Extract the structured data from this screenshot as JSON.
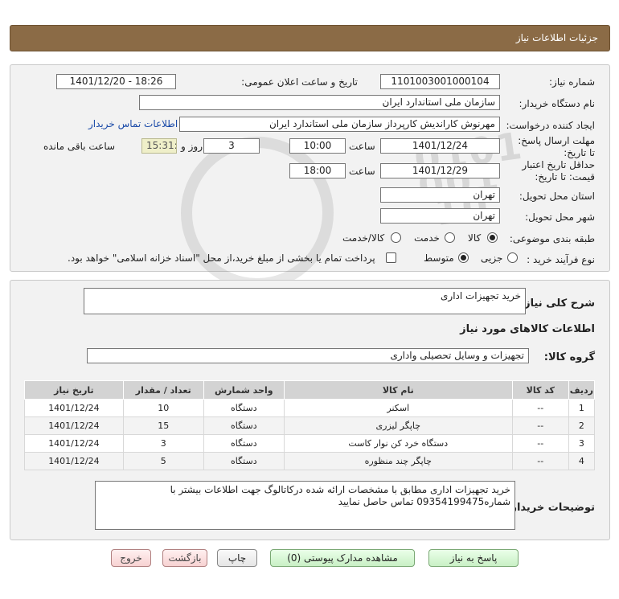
{
  "header": {
    "title": "جزئیات اطلاعات نیاز"
  },
  "form": {
    "need_number_label": "شماره نیاز:",
    "need_number": "1101003001000104",
    "announce_label": "تاریخ و ساعت اعلان عمومی:",
    "announce_value": "1401/12/20 - 18:26",
    "buyer_org_label": "نام دستگاه خریدار:",
    "buyer_org": "سازمان ملی استاندارد ایران",
    "creator_label": "ایجاد کننده درخواست:",
    "creator": "مهرنوش کاراندیش کارپرداز سازمان ملی استاندارد ایران",
    "contact_link": "اطلاعات تماس خریدار",
    "reply_deadline_label": "مهلت ارسال پاسخ: تا تاریخ:",
    "reply_date": "1401/12/24",
    "time_label": "ساعت",
    "reply_time": "10:00",
    "days_value": "3",
    "days_and_label": "روز و",
    "remaining_time": "15:31:46",
    "remaining_label": "ساعت باقی مانده",
    "validity_label": "حداقل تاریخ اعتبار قیمت: تا تاریخ:",
    "validity_date": "1401/12/29",
    "validity_time": "18:00",
    "province_label": "استان محل تحویل:",
    "province": "تهران",
    "city_label": "شهر محل تحویل:",
    "city": "تهران",
    "category_label": "طبقه بندی موضوعی:",
    "category_options": [
      "کالا",
      "خدمت",
      "کالا/خدمت"
    ],
    "process_label": "نوع فرآیند خرید :",
    "process_options": [
      "جزیی",
      "متوسط"
    ],
    "payment_note": "پرداخت تمام یا بخشی از مبلغ خرید،از محل \"اسناد خزانه اسلامی\" خواهد بود."
  },
  "summary": {
    "general_desc_label": "شرح کلی نیاز:",
    "general_desc": "خرید تجهیزات اداری",
    "goods_info_title": "اطلاعات کالاهای مورد نیاز",
    "goods_group_label": "گروه کالا:",
    "goods_group": "تجهیزات و وسایل تحصیلی واداری"
  },
  "table": {
    "headers": [
      "ردیف",
      "کد کالا",
      "نام کالا",
      "واحد شمارش",
      "تعداد / مقدار",
      "تاریخ نیاز"
    ],
    "rows": [
      [
        "1",
        "--",
        "اسکنر",
        "دستگاه",
        "10",
        "1401/12/24"
      ],
      [
        "2",
        "--",
        "چاپگر لیزری",
        "دستگاه",
        "15",
        "1401/12/24"
      ],
      [
        "3",
        "--",
        "دستگاه خرد کن نوار کاست",
        "دستگاه",
        "3",
        "1401/12/24"
      ],
      [
        "4",
        "--",
        "چاپگر چند منظوره",
        "دستگاه",
        "5",
        "1401/12/24"
      ]
    ]
  },
  "buyer_notes": {
    "label": "توضیحات خریدار:",
    "text": "خرید تجهیزات اداری مطابق با مشخصات ارائه شده درکاتالوگ جهت اطلاعات بیشتر با شماره09354199475 تماس حاصل نمایید"
  },
  "buttons": {
    "reply": "پاسخ به نیاز",
    "view_docs": "مشاهده مدارک پیوستی (0)",
    "print": "چاپ",
    "back": "بازگشت",
    "exit": "خروج"
  },
  "watermark": {
    "brand": "ParsNamadData",
    "line1": "پایگاه اطلاع رسانی مناقصات و مزایده",
    "phone": "۰۲۱-۸۸۳۴۹۶۷۰-۵",
    "number": "0101 001 10"
  },
  "colors": {
    "header_bg": "#8b6b46",
    "panel_bg": "#f2f2f2",
    "link": "#1a4aa8",
    "reply_btn": "#c9f0c5",
    "back_btn": "#f7d2d2"
  }
}
